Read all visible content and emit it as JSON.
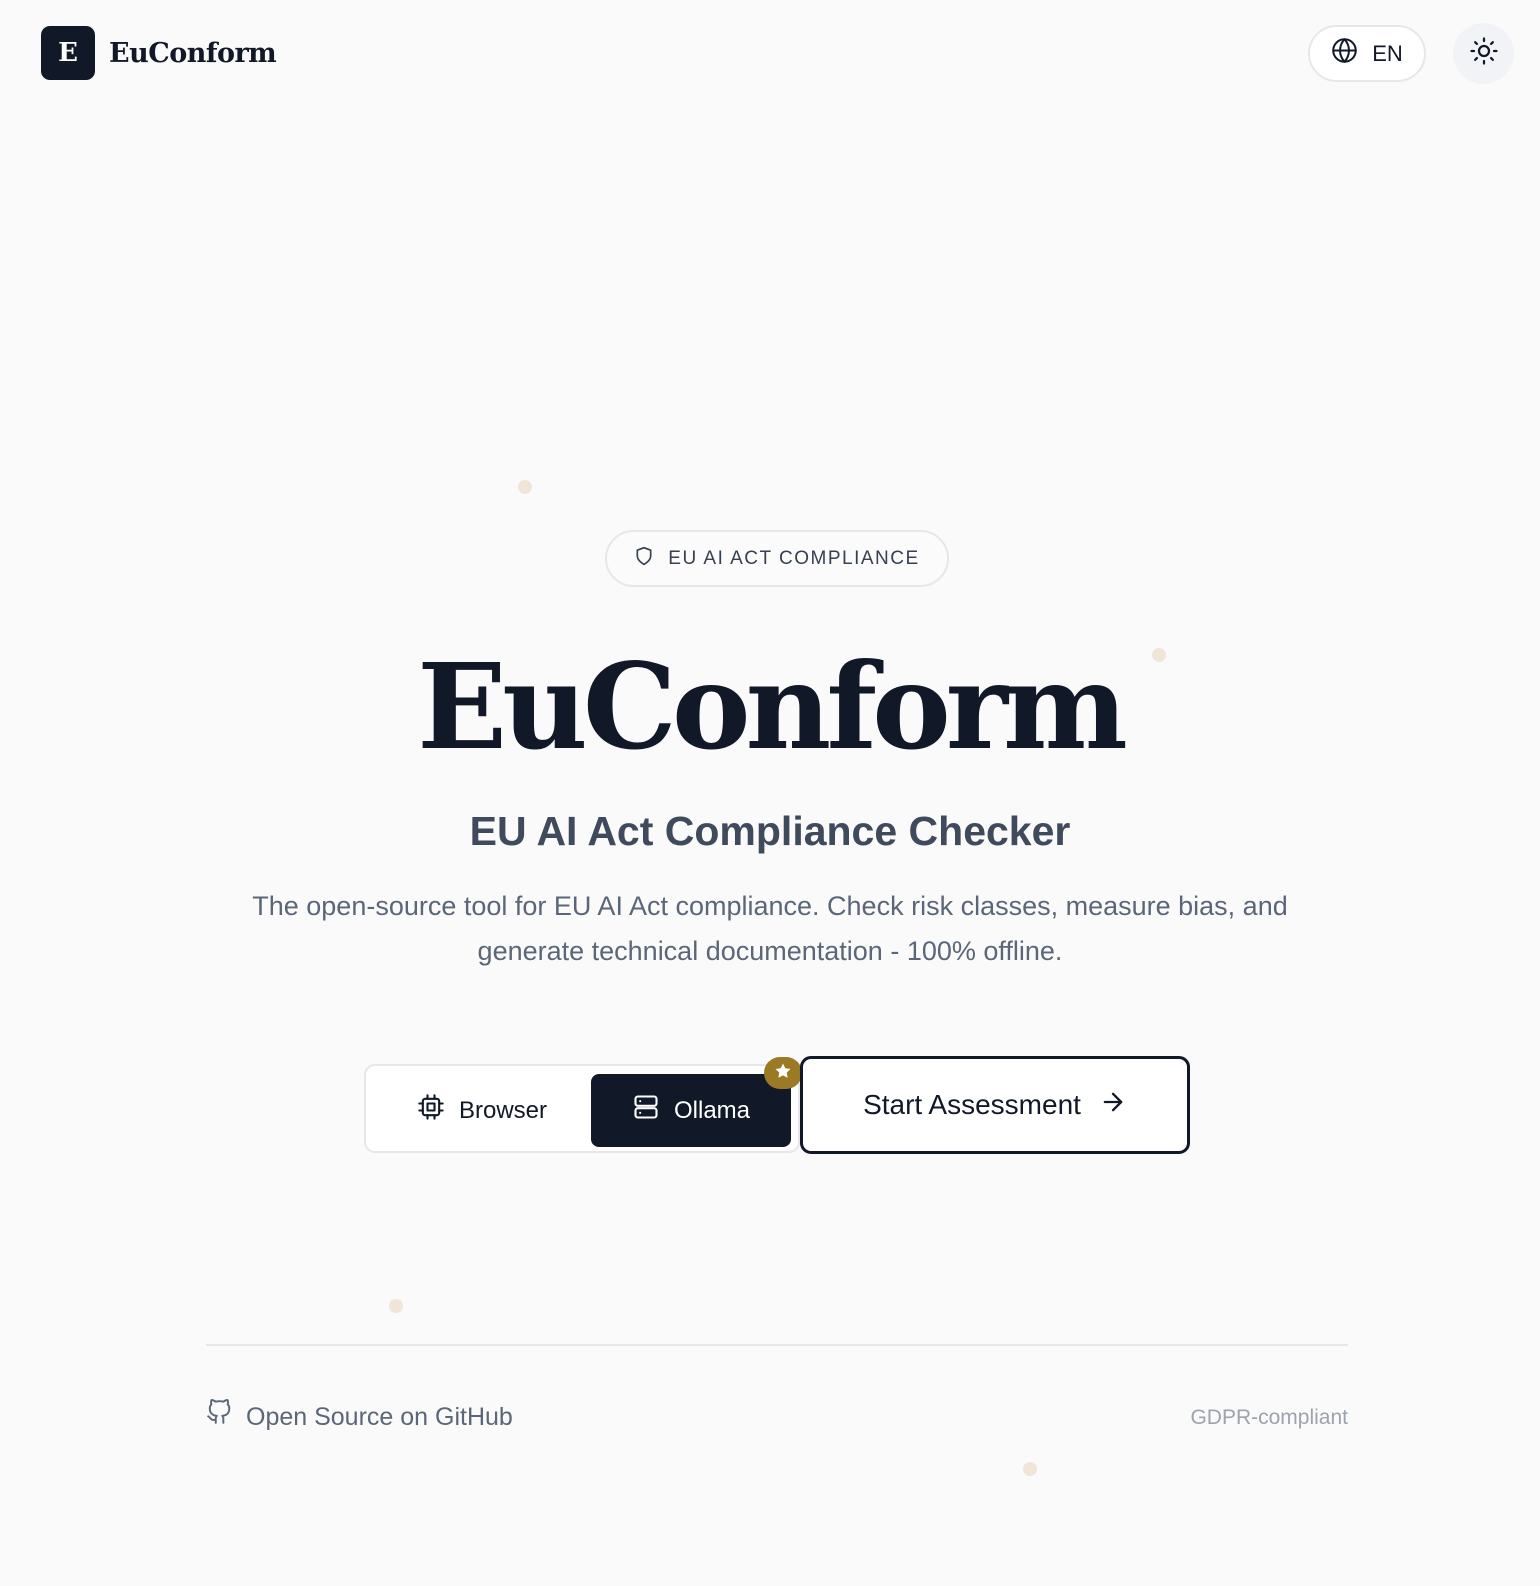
{
  "header": {
    "logo_letter": "E",
    "brand": "EuConform",
    "language": "EN",
    "language_icon": "globe-icon",
    "theme_icon": "sun-icon"
  },
  "hero": {
    "badge_icon": "shield-icon",
    "badge": "EU AI ACT COMPLIANCE",
    "title": "EuConform",
    "subtitle": "EU AI Act Compliance Checker",
    "description": "The open-source tool for EU AI Act compliance. Check risk classes, measure bias, and generate technical documentation - 100% offline."
  },
  "mode_toggle": {
    "options": [
      {
        "label": "Browser",
        "icon": "cpu-chip-icon",
        "selected": false
      },
      {
        "label": "Ollama",
        "icon": "server-icon",
        "selected": true
      }
    ],
    "recommended_icon": "star-icon"
  },
  "cta": {
    "label": "Start Assessment",
    "icon": "arrow-right-icon"
  },
  "footer": {
    "github_icon": "github-icon",
    "github_label": "Open Source on GitHub",
    "gdpr_label": "GDPR-compliant"
  },
  "colors": {
    "background": "#fafafa",
    "primary": "#111827",
    "accent_gold": "#9a7a25",
    "muted_text": "#5b6778",
    "border": "#e5e7eb",
    "decor_dot": "#efe6d8"
  }
}
